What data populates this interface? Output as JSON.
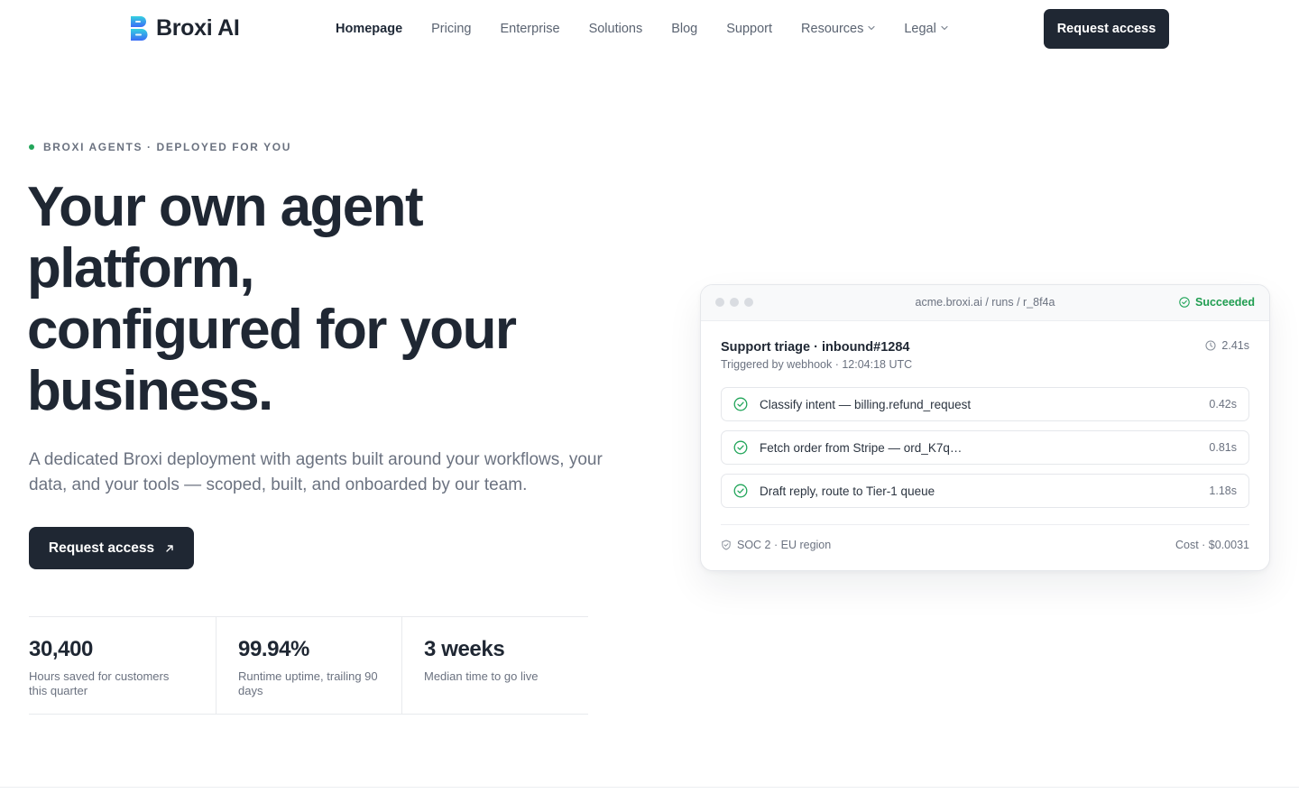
{
  "nav": {
    "brand": "Broxi AI",
    "links": [
      {
        "label": "Homepage",
        "active": true
      },
      {
        "label": "Pricing"
      },
      {
        "label": "Enterprise"
      },
      {
        "label": "Solutions"
      },
      {
        "label": "Blog"
      },
      {
        "label": "Support"
      },
      {
        "label": "Resources",
        "dropdown": true
      },
      {
        "label": "Legal",
        "dropdown": true
      }
    ],
    "cta": "Request access"
  },
  "hero": {
    "eyebrow": "BROXI AGENTS · DEPLOYED FOR YOU",
    "title_lines": [
      "Your own agent",
      "platform,",
      "configured for your",
      "business."
    ],
    "subtitle": "A dedicated Broxi deployment with agents built around your workflows, your data, and your tools — scoped, built, and onboarded by our team.",
    "cta": "Request access"
  },
  "stats": [
    {
      "value": "30,400",
      "label": "Hours saved for customers this quarter"
    },
    {
      "value": "99.94%",
      "label": "Runtime uptime, trailing 90 days"
    },
    {
      "value": "3 weeks",
      "label": "Median time to go live"
    }
  ],
  "run_card": {
    "url": "acme.broxi.ai / runs / r_8f4a",
    "status": "Succeeded",
    "title": "Support triage · inbound#1284",
    "trigger": "Triggered by webhook · 12:04:18 UTC",
    "duration": "2.41s",
    "steps": [
      {
        "label": "Classify intent — billing.refund_request",
        "time": "0.42s"
      },
      {
        "label": "Fetch order from Stripe — ord_K7q…",
        "time": "0.81s"
      },
      {
        "label": "Draft reply, route to Tier-1 queue",
        "time": "1.18s"
      }
    ],
    "compliance": "SOC 2 · EU region",
    "cost": "Cost · $0.0031"
  },
  "colors": {
    "primary_dark": "#1f2733",
    "success_green": "#22a55a",
    "muted_text": "#6b7280",
    "logo_gradient": [
      "#2ec4e6",
      "#3b6cf6"
    ]
  },
  "icons": [
    "broxi-logo-icon",
    "chevron-down-icon",
    "arrow-up-right-icon",
    "check-circle-icon",
    "clock-icon",
    "shield-icon"
  ]
}
